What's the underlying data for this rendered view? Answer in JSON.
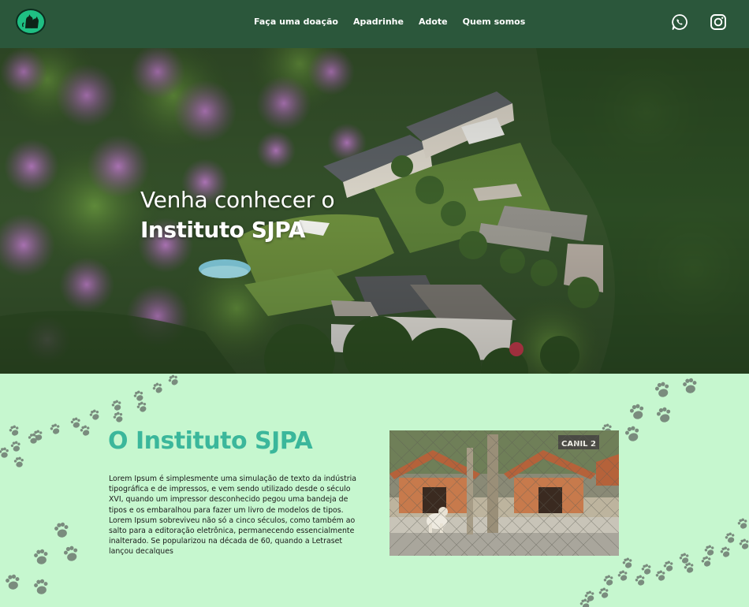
{
  "header": {
    "logo_icon": "dog-cat-logo-icon",
    "nav": [
      {
        "label": "Faça uma doação"
      },
      {
        "label": "Apadrinhe"
      },
      {
        "label": "Adote"
      },
      {
        "label": "Quem somos"
      }
    ],
    "social": [
      {
        "icon": "whatsapp-icon"
      },
      {
        "icon": "instagram-icon"
      }
    ],
    "background": "#2b573b"
  },
  "hero": {
    "line1": "Venha conhecer o",
    "line2": "Instituto SJPA"
  },
  "about": {
    "title": "O Instituto SJPA",
    "body": "Lorem Ipsum é simplesmente uma simulação de texto da indústria tipográfica e de impressos, e vem sendo utilizado desde o século XVI, quando um impressor desconhecido pegou uma bandeja de tipos e os embaralhou para fazer um livro de modelos de tipos. Lorem Ipsum sobreviveu não só a cinco séculos, como também ao salto para a editoração eletrônica, permanecendo essencialmente inalterado. Se popularizou na década de 60, quando a Letraset lançou decalques",
    "photo_sign": "CANIL 2",
    "title_color": "#3bb79b",
    "background": "#c6f7cf"
  },
  "decoration": {
    "icon": "paw-print-icon"
  }
}
